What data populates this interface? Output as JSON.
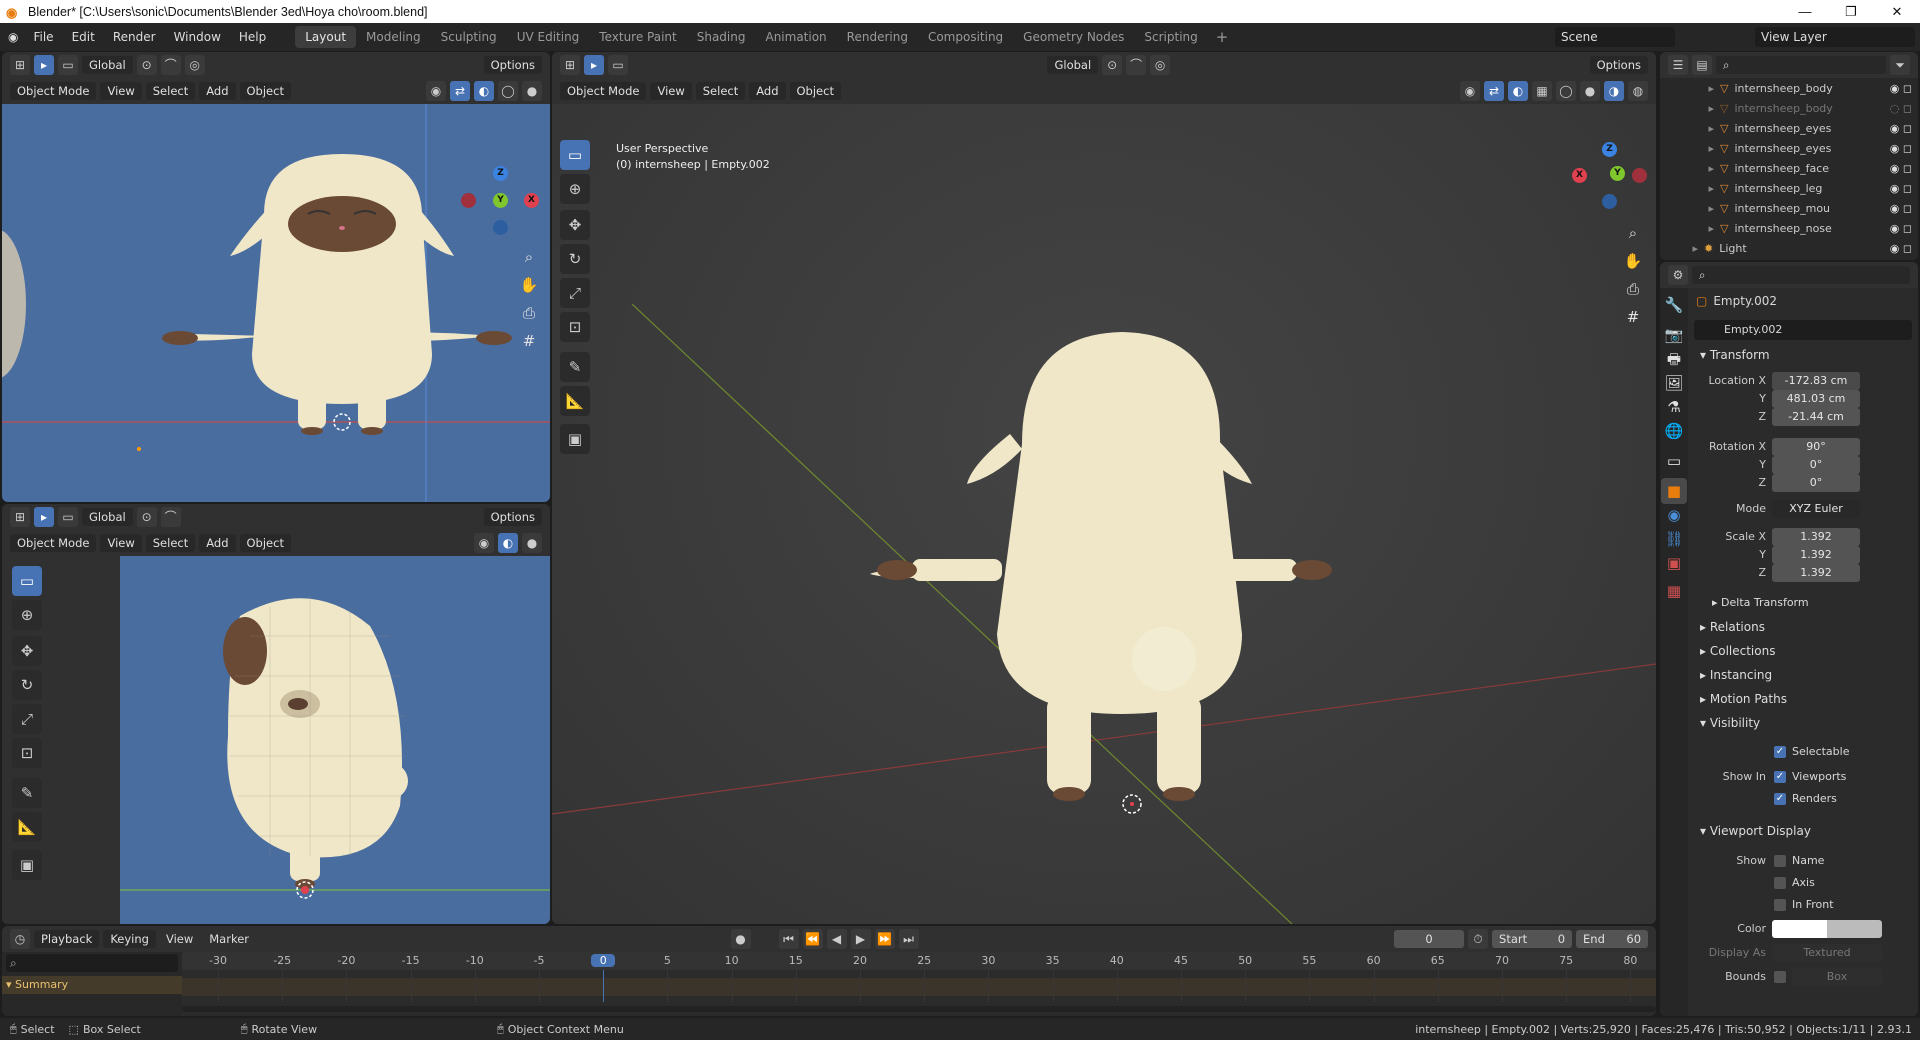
{
  "window": {
    "title": "Blender* [C:\\Users\\sonic\\Documents\\Blender 3ed\\Hoya cho\\room.blend]",
    "minimize": "—",
    "maximize": "❐",
    "close": "✕"
  },
  "menus": [
    "File",
    "Edit",
    "Render",
    "Window",
    "Help"
  ],
  "workspaces": [
    "Layout",
    "Modeling",
    "Sculpting",
    "UV Editing",
    "Texture Paint",
    "Shading",
    "Animation",
    "Rendering",
    "Compositing",
    "Geometry Nodes",
    "Scripting"
  ],
  "active_workspace": "Layout",
  "scene": "Scene",
  "view_layer": "View Layer",
  "viewport_header": {
    "options": "Options",
    "mode": "Object Mode",
    "view": "View",
    "select": "Select",
    "add": "Add",
    "object": "Object",
    "orientation": "Global"
  },
  "main_viewport": {
    "line1": "User Perspective",
    "line2": "(0) internsheep | Empty.002"
  },
  "outliner": {
    "items": [
      {
        "name": "internsheep_body",
        "dim": false
      },
      {
        "name": "internsheep_body",
        "dim": true
      },
      {
        "name": "internsheep_eyes",
        "dim": false
      },
      {
        "name": "internsheep_eyes",
        "dim": false
      },
      {
        "name": "internsheep_face",
        "dim": false
      },
      {
        "name": "internsheep_leg",
        "dim": false
      },
      {
        "name": "internsheep_mou",
        "dim": false
      },
      {
        "name": "internsheep_nose",
        "dim": false
      },
      {
        "name": "Light",
        "dim": false
      }
    ]
  },
  "properties": {
    "object_name": "Empty.002",
    "data_name": "Empty.002",
    "transform_label": "Transform",
    "location": {
      "label": "Location X",
      "x": "-172.83 cm",
      "y": "481.03 cm",
      "z": "-21.44 cm"
    },
    "rotation": {
      "label": "Rotation X",
      "x": "90°",
      "y": "0°",
      "z": "0°"
    },
    "mode_label": "Mode",
    "mode_value": "XYZ Euler",
    "scale": {
      "label": "Scale X",
      "x": "1.392",
      "y": "1.392",
      "z": "1.392"
    },
    "axis_y": "Y",
    "axis_z": "Z",
    "delta": "Delta Transform",
    "sections": [
      "Relations",
      "Collections",
      "Instancing",
      "Motion Paths"
    ],
    "visibility": "Visibility",
    "selectable": "Selectable",
    "show_in": "Show In",
    "viewports": "Viewports",
    "renders": "Renders",
    "viewport_display": "Viewport Display",
    "show": "Show",
    "name": "Name",
    "axis": "Axis",
    "in_front": "In Front",
    "color": "Color",
    "display_as": "Display As",
    "display_as_value": "Textured",
    "bounds": "Bounds",
    "bounds_value": "Box"
  },
  "timeline": {
    "playback": "Playback",
    "keying": "Keying",
    "view": "View",
    "marker": "Marker",
    "current_frame": "0",
    "start_label": "Start",
    "start": "0",
    "end_label": "End",
    "end": "60",
    "ticks": [
      "-30",
      "-25",
      "-20",
      "-15",
      "-10",
      "-5",
      "0",
      "5",
      "10",
      "15",
      "20",
      "25",
      "30",
      "35",
      "40",
      "45",
      "50",
      "55",
      "60",
      "65",
      "70",
      "75",
      "80"
    ],
    "summary": "Summary"
  },
  "statusbar": {
    "select": "Select",
    "box_select": "Box Select",
    "rotate": "Rotate View",
    "context": "Object Context Menu",
    "stats": "internsheep | Empty.002 | Verts:25,920 | Faces:25,476 | Tris:50,952 | Objects:1/11 | 2.93.1"
  },
  "colors": {
    "accent": "#4772b3",
    "ortho_bg": "#4a6da0",
    "persp_bg": "#3a3a3a",
    "x_axis": "#e0414f",
    "y_axis": "#7fc72c",
    "z_axis": "#3b83e0",
    "sheep": "#efe7c8",
    "sheep_face": "#6b4a35"
  }
}
